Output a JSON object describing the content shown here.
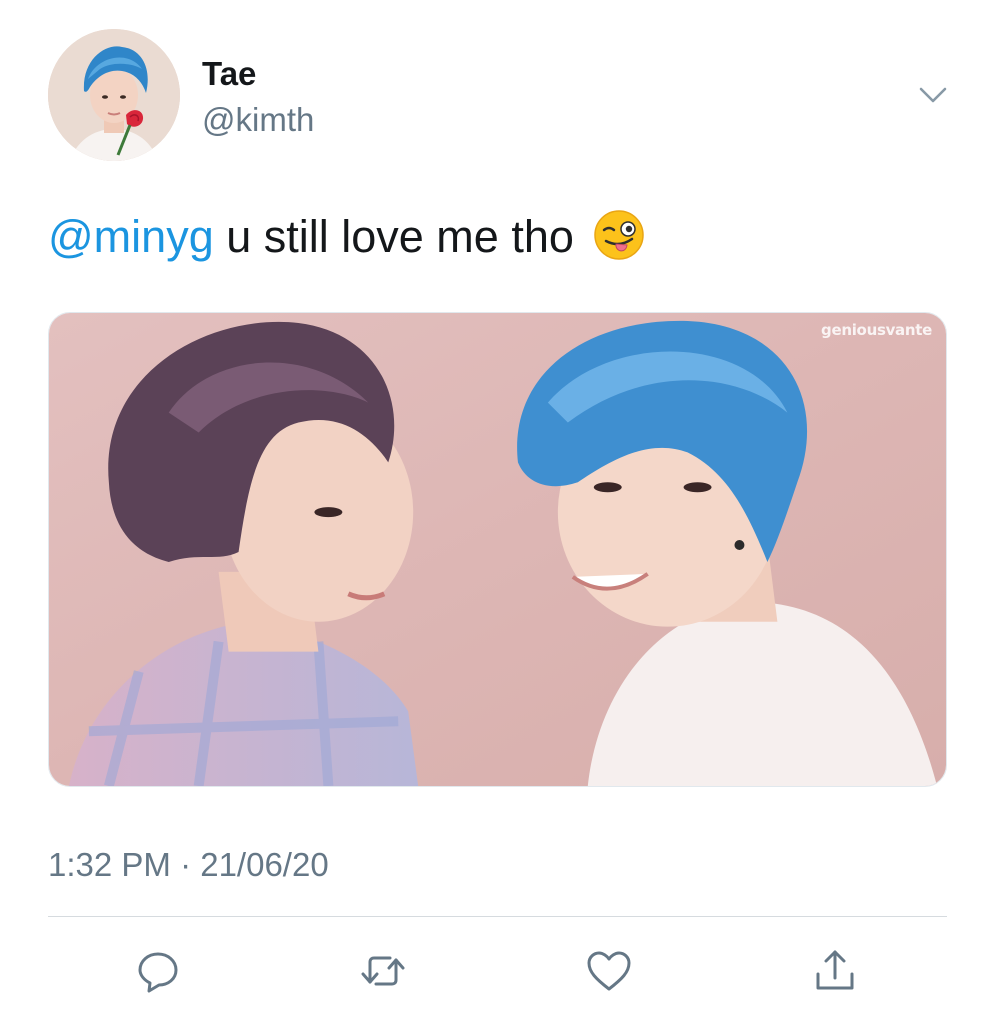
{
  "user": {
    "name": "Tae",
    "handle": "@kimth"
  },
  "tweet": {
    "mention": "@minyg",
    "text": " u still love me tho",
    "emoji": "winking-face-with-tongue",
    "timestamp": "1:32 PM · 21/06/20"
  },
  "media": {
    "watermark": "geniousvante"
  },
  "actions": [
    {
      "name": "reply",
      "icon": "reply-icon"
    },
    {
      "name": "retweet",
      "icon": "retweet-icon"
    },
    {
      "name": "like",
      "icon": "heart-icon"
    },
    {
      "name": "share",
      "icon": "share-icon"
    }
  ],
  "colors": {
    "link": "#1b95e0",
    "secondary_text": "#657786",
    "icon": "#657786",
    "primary_text": "#14171a"
  }
}
